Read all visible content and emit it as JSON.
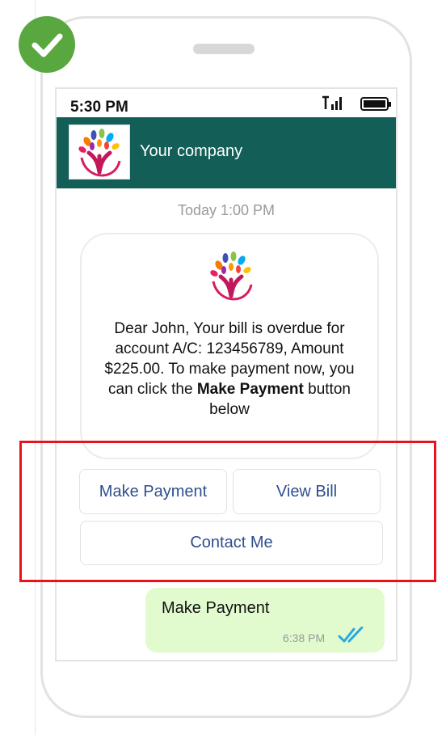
{
  "status_bar": {
    "time": "5:30 PM",
    "signal_icon": "signal-icon",
    "battery_icon": "battery-icon"
  },
  "header": {
    "company": "Your company",
    "logo_icon": "tree-logo-icon",
    "background_color": "#135e57"
  },
  "chat": {
    "timestamp": "Today 1:00 PM",
    "message": {
      "text_before": "Dear John, Your bill is overdue for account A/C: 123456789, Amount $225.00. To make payment now, you can click the ",
      "bold": "Make Payment",
      "text_after": " button below"
    },
    "buttons": [
      {
        "label": "Make Payment"
      },
      {
        "label": "View Bill"
      },
      {
        "label": "Contact Me"
      }
    ],
    "reply": {
      "text": "Make Payment",
      "time": "6:38 PM",
      "status_icon": "double-check-icon"
    }
  },
  "badges": {
    "check_icon": "check-circle-icon",
    "highlight_color": "#e8131b",
    "badge_color": "#58a83f"
  }
}
